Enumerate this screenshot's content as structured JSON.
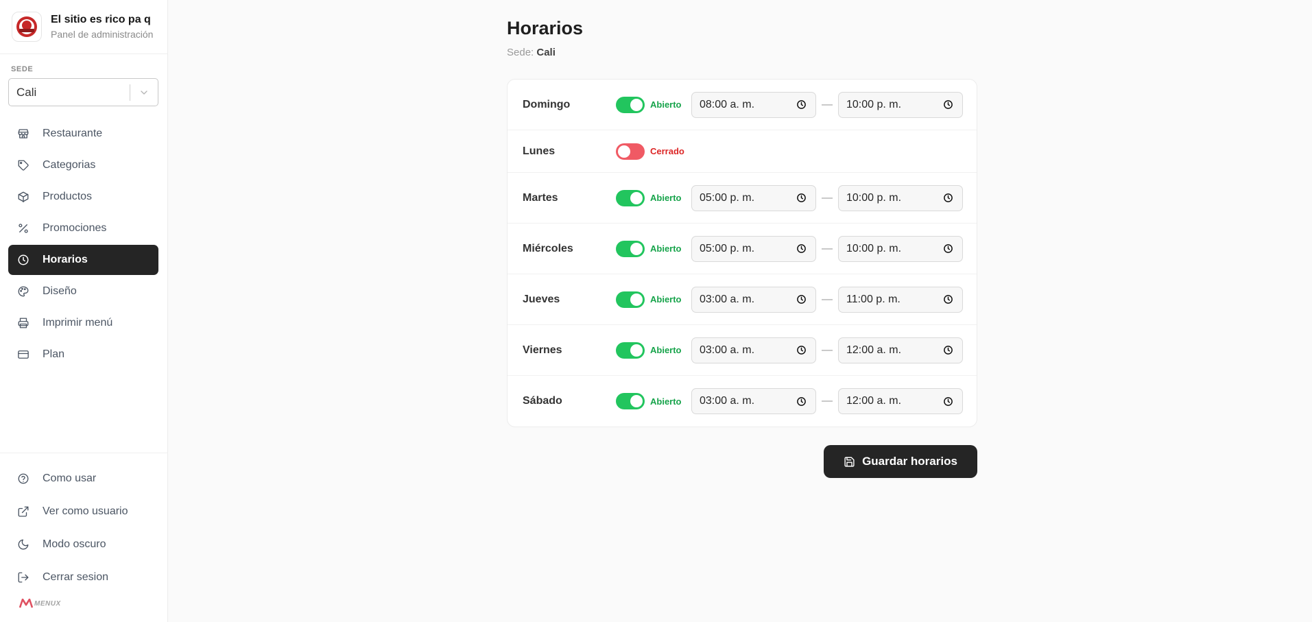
{
  "brand": {
    "name": "El sitio es rico pa q",
    "subtitle": "Panel de administración"
  },
  "sidebar": {
    "sede_label": "SEDE",
    "sede_value": "Cali",
    "nav": [
      {
        "label": "Restaurante",
        "icon": "store-icon"
      },
      {
        "label": "Categorias",
        "icon": "tag-icon"
      },
      {
        "label": "Productos",
        "icon": "box-icon"
      },
      {
        "label": "Promociones",
        "icon": "percent-icon"
      },
      {
        "label": "Horarios",
        "icon": "clock-icon",
        "active": true
      },
      {
        "label": "Diseño",
        "icon": "palette-icon"
      },
      {
        "label": "Imprimir menú",
        "icon": "printer-icon"
      },
      {
        "label": "Plan",
        "icon": "credit-card-icon"
      }
    ],
    "bottom_nav": [
      {
        "label": "Como usar",
        "icon": "help-circle-icon"
      },
      {
        "label": "Ver como usuario",
        "icon": "external-link-icon"
      },
      {
        "label": "Modo oscuro",
        "icon": "moon-icon"
      },
      {
        "label": "Cerrar sesion",
        "icon": "logout-icon"
      }
    ],
    "footer_logo": "MENUX"
  },
  "main": {
    "title": "Horarios",
    "sede_prefix": "Sede:",
    "sede_name": "Cali",
    "open_label": "Abierto",
    "closed_label": "Cerrado",
    "dash": "—",
    "schedule": [
      {
        "day": "Domingo",
        "open": true,
        "from": "08:00 a. m.",
        "to": "10:00 p. m."
      },
      {
        "day": "Lunes",
        "open": false,
        "from": "",
        "to": ""
      },
      {
        "day": "Martes",
        "open": true,
        "from": "05:00 p. m.",
        "to": "10:00 p. m."
      },
      {
        "day": "Miércoles",
        "open": true,
        "from": "05:00 p. m.",
        "to": "10:00 p. m."
      },
      {
        "day": "Jueves",
        "open": true,
        "from": "03:00 a. m.",
        "to": "11:00 p. m."
      },
      {
        "day": "Viernes",
        "open": true,
        "from": "03:00 a. m.",
        "to": "12:00 a. m."
      },
      {
        "day": "Sábado",
        "open": true,
        "from": "03:00 a. m.",
        "to": "12:00 a. m."
      }
    ],
    "save_label": "Guardar horarios"
  },
  "colors": {
    "accent_dark": "#252525",
    "open_green": "#22c55e",
    "closed_red": "#f05a64"
  }
}
